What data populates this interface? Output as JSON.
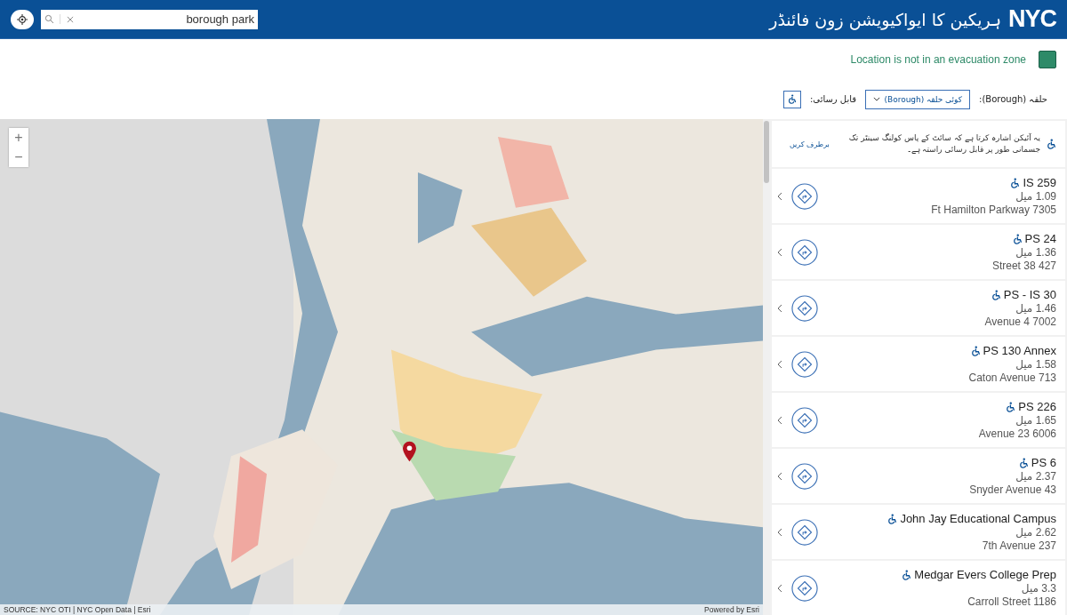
{
  "header": {
    "title": "ہریکین کا ایواکیویشن زون فائنڈر",
    "logo": "NYC",
    "search": {
      "value": "borough park"
    }
  },
  "zone_status": {
    "text": "Location is not in an evacuation zone",
    "color": "#2e8a68"
  },
  "filters": {
    "borough_label": "حلقہ (Borough):",
    "borough_select": "کوئی حلقہ (Borough)",
    "accessible_label": "قابل رسائی:"
  },
  "map": {
    "zoom_in": "+",
    "zoom_out": "−",
    "attribution": "SOURCE: NYC OTI | NYC Open Data | Esri",
    "powered_by": "Powered by Esri"
  },
  "panel": {
    "note": "یہ آئیکن اشارہ کرتا ہے کہ سائٹ کے پاس کولنگ سینٹر تک جسمانی طور پر قابل رسائی راستہ ہے۔",
    "dismiss": "برطرف کریں",
    "sites": [
      {
        "name": "IS 259",
        "accessible": true,
        "distance": "1.09 میل",
        "address": "Ft Hamilton Parkway 7305"
      },
      {
        "name": "PS 24",
        "accessible": true,
        "distance": "1.36 میل",
        "address": "Street 38 427"
      },
      {
        "name": "PS - IS 30",
        "accessible": true,
        "distance": "1.46 میل",
        "address": "Avenue 4 7002"
      },
      {
        "name": "PS 130 Annex",
        "accessible": true,
        "distance": "1.58 میل",
        "address": "Caton Avenue 713"
      },
      {
        "name": "PS 226",
        "accessible": true,
        "distance": "1.65 میل",
        "address": "Avenue 23 6006"
      },
      {
        "name": "PS 6",
        "accessible": true,
        "distance": "2.37 میل",
        "address": "Snyder Avenue 43"
      },
      {
        "name": "John Jay Educational Campus",
        "accessible": true,
        "distance": "2.62 میل",
        "address": "7th Avenue 237"
      },
      {
        "name": "Medgar Evers College Prep",
        "accessible": true,
        "distance": "3.3 میل",
        "address": "Carroll Street 1186"
      }
    ]
  }
}
